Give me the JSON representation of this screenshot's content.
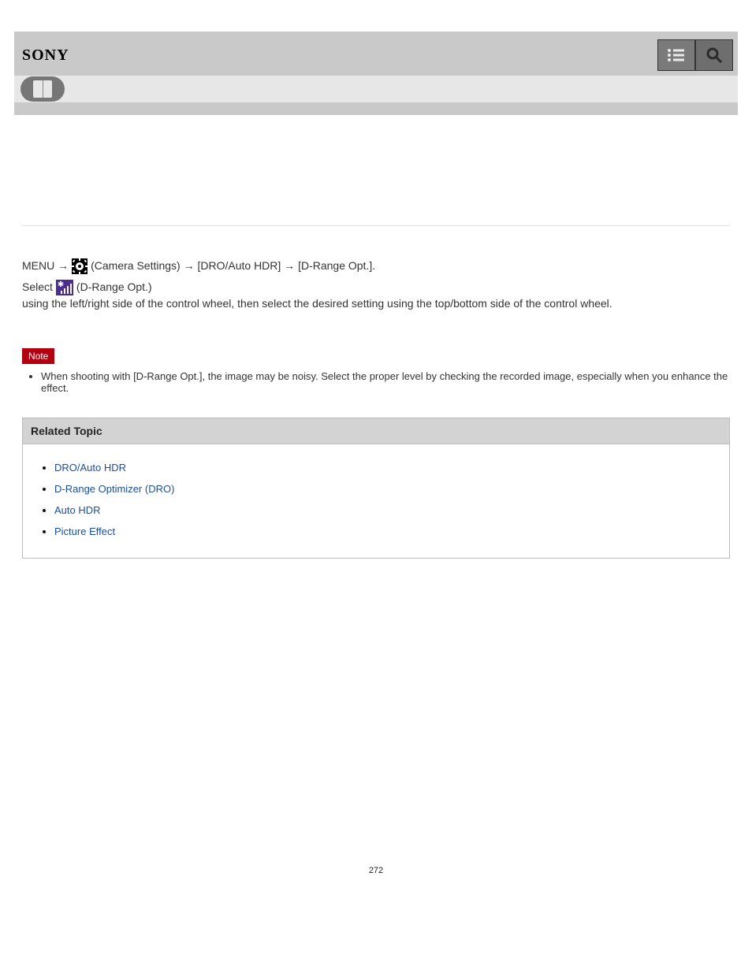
{
  "header": {
    "logo": "SONY",
    "menu_icon": "menu-icon",
    "search_icon": "search-icon",
    "book_icon": "help-guide-icon"
  },
  "article": {
    "menu_path_prefix": "MENU → ",
    "settings_label": " (Camera Settings) → [DRO/Auto HDR] → [D-Range Opt.].",
    "select_prefix": "Select ",
    "dro_label": " (D-Range Opt.)",
    "select_suffix": " using the left/right side of the control wheel, then select the desired setting using the top/bottom side of the control wheel."
  },
  "note": {
    "badge": "Note",
    "items": [
      "When shooting with [D-Range Opt.], the image may be noisy. Select the proper level by checking the recorded image, especially when you enhance the effect."
    ]
  },
  "related": {
    "title": "Related Topic",
    "links": [
      "DRO/Auto HDR",
      "D-Range Optimizer (DRO)",
      "Auto HDR",
      "Picture Effect"
    ]
  },
  "page_number": "272"
}
